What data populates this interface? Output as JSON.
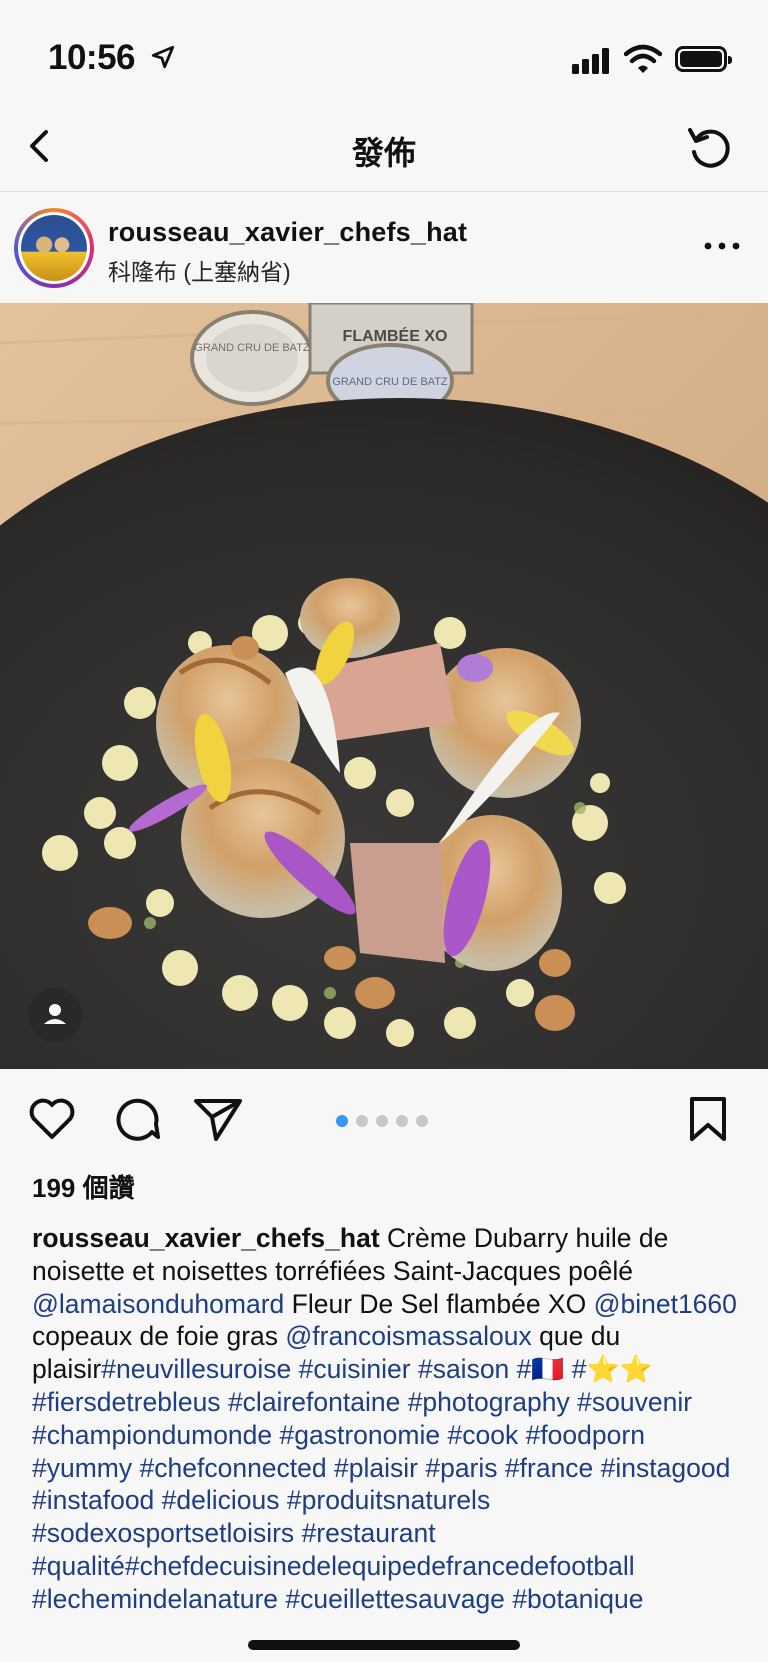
{
  "status": {
    "time": "10:56"
  },
  "nav": {
    "title": "發佈",
    "back_icon": "chevron-left-icon",
    "refresh_icon": "refresh-icon"
  },
  "post": {
    "username": "rousseau_xavier_chefs_hat",
    "location": "科隆布 (上塞納省)",
    "likes": "199 個讚",
    "carousel": {
      "count": 5,
      "active": 0
    }
  },
  "caption": [
    [
      "u",
      "rousseau_xavier_chefs_hat"
    ],
    [
      "t",
      " Crème Dubarry huile de noisette et noisettes torréfiées Saint-Jacques poêlé "
    ],
    [
      "l",
      "@lamaisonduhomard"
    ],
    [
      "t",
      " Fleur De Sel flambée XO "
    ],
    [
      "l",
      "@binet1660"
    ],
    [
      "t",
      "  copeaux de foie gras "
    ],
    [
      "l",
      "@francoismassaloux"
    ],
    [
      "t",
      " que du plaisir"
    ],
    [
      "l",
      "#neuvillesuroise"
    ],
    [
      "t",
      " "
    ],
    [
      "l",
      "#cuisinier"
    ],
    [
      "t",
      " "
    ],
    [
      "l",
      "#saison"
    ],
    [
      "t",
      " "
    ],
    [
      "l",
      "#🇫🇷"
    ],
    [
      "t",
      " "
    ],
    [
      "l",
      "#⭐⭐"
    ],
    [
      "t",
      " "
    ],
    [
      "l",
      "#fiersdetrebleus"
    ],
    [
      "t",
      " "
    ],
    [
      "l",
      "#clairefontaine"
    ],
    [
      "t",
      " "
    ],
    [
      "l",
      "#photography"
    ],
    [
      "t",
      " "
    ],
    [
      "l",
      "#souvenir"
    ],
    [
      "t",
      " "
    ],
    [
      "l",
      "#championdumonde"
    ],
    [
      "t",
      " "
    ],
    [
      "l",
      "#gastronomie"
    ],
    [
      "t",
      " "
    ],
    [
      "l",
      "#cook"
    ],
    [
      "t",
      " "
    ],
    [
      "l",
      "#foodporn"
    ],
    [
      "t",
      " "
    ],
    [
      "l",
      "#yummy"
    ],
    [
      "t",
      " "
    ],
    [
      "l",
      "#chefconnected"
    ],
    [
      "t",
      " "
    ],
    [
      "l",
      "#plaisir"
    ],
    [
      "t",
      " "
    ],
    [
      "l",
      "#paris"
    ],
    [
      "t",
      " "
    ],
    [
      "l",
      "#france"
    ],
    [
      "t",
      " "
    ],
    [
      "l",
      "#instagood"
    ],
    [
      "t",
      " "
    ],
    [
      "l",
      "#instafood"
    ],
    [
      "t",
      " "
    ],
    [
      "l",
      "#delicious"
    ],
    [
      "t",
      " "
    ],
    [
      "l",
      "#produitsnaturels"
    ],
    [
      "t",
      " "
    ],
    [
      "l",
      "#sodexosportsetloisirs"
    ],
    [
      "t",
      " "
    ],
    [
      "l",
      "#restaurant"
    ],
    [
      "t",
      " "
    ],
    [
      "l",
      "#qualité"
    ],
    [
      "l",
      "#chefdecuisinedelequipedefrancedefootball"
    ],
    [
      "t",
      " "
    ],
    [
      "l",
      "#lechemindelanature"
    ],
    [
      "t",
      " "
    ],
    [
      "l",
      "#cueillettesauvage"
    ],
    [
      "t",
      " "
    ],
    [
      "l",
      "#botanique"
    ]
  ],
  "photo": {
    "jar_labels": [
      "GRAND CRU DE BATZ",
      "FLAMBÉE XO",
      "GRAND CRU DE BATZ"
    ]
  },
  "colors": {
    "link": "#1e3d82",
    "carousel_active": "#3897f0"
  }
}
